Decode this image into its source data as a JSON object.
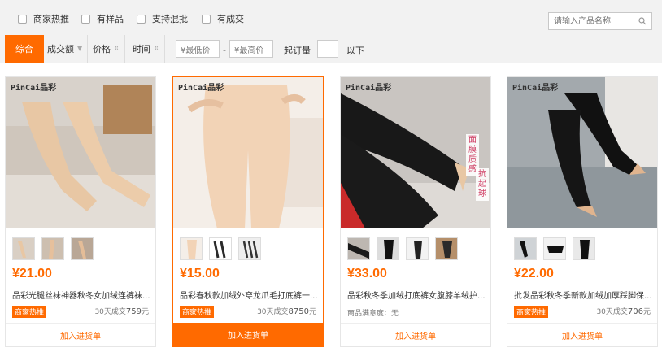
{
  "filters": {
    "checkboxes": [
      "商家热推",
      "有样品",
      "支持混批",
      "有成交"
    ],
    "search_placeholder": "请输入产品名称"
  },
  "sort": {
    "active": "综合",
    "deal_amount": "成交额",
    "price": "价格",
    "time": "时间",
    "min_price_placeholder": "¥最低价",
    "max_price_placeholder": "¥最高价",
    "dash": "-",
    "moq_label": "起订量",
    "moq_suffix": "以下"
  },
  "products": [
    {
      "brand": "PinCai品彩",
      "price": "¥21.00",
      "title": "品彩光腿丝袜神器秋冬女加绒连裤袜...",
      "tag": "商家热推",
      "sales_label": "30天成交",
      "sales_value": "759",
      "sales_unit": "元",
      "cta": "加入进货单",
      "image_colors": {
        "bg": "#c9c0b6",
        "leg": "#e8c7a4"
      }
    },
    {
      "brand": "PinCai品彩",
      "price": "¥15.00",
      "title": "品彩春秋款加绒外穿龙爪毛打底裤一...",
      "tag": "商家热推",
      "sales_label": "30天成交",
      "sales_value": "8750",
      "sales_unit": "元",
      "cta": "加入进货单",
      "image_colors": {
        "bg": "#f3ece6",
        "leg": "#f2d3b6"
      }
    },
    {
      "brand": "PinCai品彩",
      "price": "¥33.00",
      "title": "品彩秋冬季加绒打底裤女腹膝羊绒护...",
      "satisfaction": "商品满意度：无",
      "side_text": [
        "面膜质感",
        "抗起球"
      ],
      "cta": "加入进货单",
      "image_colors": {
        "bg": "#c8c4c0",
        "leg": "#1a1a1a"
      }
    },
    {
      "brand": "PinCai品彩",
      "price": "¥22.00",
      "title": "批发品彩秋冬季新款加绒加厚踩脚保...",
      "tag": "商家热推",
      "sales_label": "30天成交",
      "sales_value": "706",
      "sales_unit": "元",
      "cta": "加入进货单",
      "image_colors": {
        "bg": "#9aa1a6",
        "leg": "#111111"
      }
    }
  ],
  "colors": {
    "accent": "#ff6a00"
  }
}
